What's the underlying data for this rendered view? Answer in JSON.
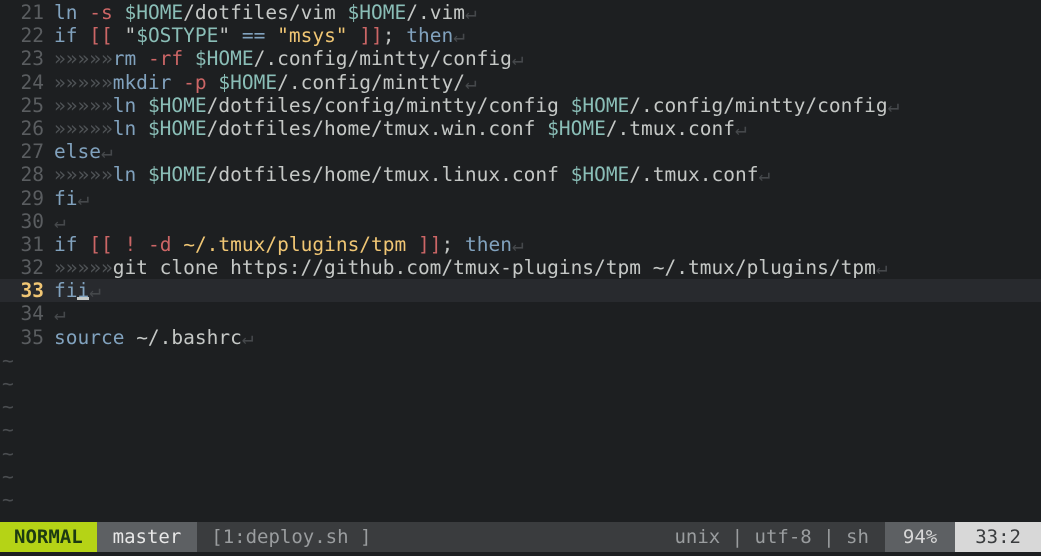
{
  "editor": {
    "name": "vim",
    "filetype": "sh",
    "tab_char": "»",
    "eol_char": "↵",
    "tilde_char": "~",
    "colors": {
      "background": "#1d1f21",
      "cursorline_bg": "#282a2e",
      "linenr": "#5a5d60",
      "cursor_linenr": "#f0c674",
      "keyword": "#81a2be",
      "operator": "#cc6666",
      "variable": "#8abeb7",
      "string": "#f0c674",
      "plain": "#c5c8c6",
      "tab_marker": "#4f5356",
      "eol_marker": "#45484b",
      "tilde": "#4a4d50",
      "mode_bg": "#b5d316",
      "mode_fg": "#1d3a12",
      "branch_bg": "#5d6063",
      "file_bg": "#3a3c3e",
      "pos_bg": "#d8d8d8"
    }
  },
  "lines": [
    {
      "number": "21",
      "cursor": false,
      "tokens": [
        {
          "cls": "t-kw",
          "text": "ln"
        },
        {
          "cls": "t-plain",
          "text": " "
        },
        {
          "cls": "t-op",
          "text": "-s"
        },
        {
          "cls": "t-plain",
          "text": " "
        },
        {
          "cls": "t-var",
          "text": "$HOME"
        },
        {
          "cls": "t-plain",
          "text": "/dotfiles/vim "
        },
        {
          "cls": "t-var",
          "text": "$HOME"
        },
        {
          "cls": "t-plain",
          "text": "/.vim"
        },
        {
          "cls": "t-eol",
          "text": "↵"
        }
      ]
    },
    {
      "number": "22",
      "cursor": false,
      "tokens": [
        {
          "cls": "t-kw",
          "text": "if"
        },
        {
          "cls": "t-plain",
          "text": " "
        },
        {
          "cls": "t-op",
          "text": "[["
        },
        {
          "cls": "t-plain",
          "text": " \""
        },
        {
          "cls": "t-var",
          "text": "$OSTYPE"
        },
        {
          "cls": "t-plain",
          "text": "\" "
        },
        {
          "cls": "t-kw",
          "text": "=="
        },
        {
          "cls": "t-plain",
          "text": " "
        },
        {
          "cls": "t-str",
          "text": "\"msys\""
        },
        {
          "cls": "t-plain",
          "text": " "
        },
        {
          "cls": "t-op",
          "text": "]]"
        },
        {
          "cls": "t-punct",
          "text": "; "
        },
        {
          "cls": "t-kw",
          "text": "then"
        },
        {
          "cls": "t-eol",
          "text": "↵"
        }
      ]
    },
    {
      "number": "23",
      "cursor": false,
      "tokens": [
        {
          "cls": "t-tab",
          "text": "»»»»»"
        },
        {
          "cls": "t-kw",
          "text": "rm"
        },
        {
          "cls": "t-plain",
          "text": " "
        },
        {
          "cls": "t-op",
          "text": "-rf"
        },
        {
          "cls": "t-plain",
          "text": " "
        },
        {
          "cls": "t-var",
          "text": "$HOME"
        },
        {
          "cls": "t-plain",
          "text": "/.config/mintty/config"
        },
        {
          "cls": "t-eol",
          "text": "↵"
        }
      ]
    },
    {
      "number": "24",
      "cursor": false,
      "tokens": [
        {
          "cls": "t-tab",
          "text": "»»»»»"
        },
        {
          "cls": "t-kw",
          "text": "mkdir"
        },
        {
          "cls": "t-plain",
          "text": " "
        },
        {
          "cls": "t-op",
          "text": "-p"
        },
        {
          "cls": "t-plain",
          "text": " "
        },
        {
          "cls": "t-var",
          "text": "$HOME"
        },
        {
          "cls": "t-plain",
          "text": "/.config/mintty/"
        },
        {
          "cls": "t-eol",
          "text": "↵"
        }
      ]
    },
    {
      "number": "25",
      "cursor": false,
      "tokens": [
        {
          "cls": "t-tab",
          "text": "»»»»»"
        },
        {
          "cls": "t-kw",
          "text": "ln"
        },
        {
          "cls": "t-plain",
          "text": " "
        },
        {
          "cls": "t-var",
          "text": "$HOME"
        },
        {
          "cls": "t-plain",
          "text": "/dotfiles/config/mintty/config "
        },
        {
          "cls": "t-var",
          "text": "$HOME"
        },
        {
          "cls": "t-plain",
          "text": "/.config/mintty/config"
        },
        {
          "cls": "t-eol",
          "text": "↵"
        }
      ]
    },
    {
      "number": "26",
      "cursor": false,
      "tokens": [
        {
          "cls": "t-tab",
          "text": "»»»»»"
        },
        {
          "cls": "t-kw",
          "text": "ln"
        },
        {
          "cls": "t-plain",
          "text": " "
        },
        {
          "cls": "t-var",
          "text": "$HOME"
        },
        {
          "cls": "t-plain",
          "text": "/dotfiles/home/tmux.win.conf "
        },
        {
          "cls": "t-var",
          "text": "$HOME"
        },
        {
          "cls": "t-plain",
          "text": "/.tmux.conf"
        },
        {
          "cls": "t-eol",
          "text": "↵"
        }
      ]
    },
    {
      "number": "27",
      "cursor": false,
      "tokens": [
        {
          "cls": "t-kw",
          "text": "else"
        },
        {
          "cls": "t-eol",
          "text": "↵"
        }
      ]
    },
    {
      "number": "28",
      "cursor": false,
      "tokens": [
        {
          "cls": "t-tab",
          "text": "»»»»»"
        },
        {
          "cls": "t-kw",
          "text": "ln"
        },
        {
          "cls": "t-plain",
          "text": " "
        },
        {
          "cls": "t-var",
          "text": "$HOME"
        },
        {
          "cls": "t-plain",
          "text": "/dotfiles/home/tmux.linux.conf "
        },
        {
          "cls": "t-var",
          "text": "$HOME"
        },
        {
          "cls": "t-plain",
          "text": "/.tmux.conf"
        },
        {
          "cls": "t-eol",
          "text": "↵"
        }
      ]
    },
    {
      "number": "29",
      "cursor": false,
      "tokens": [
        {
          "cls": "t-kw",
          "text": "fi"
        },
        {
          "cls": "t-eol",
          "text": "↵"
        }
      ]
    },
    {
      "number": "30",
      "cursor": false,
      "tokens": [
        {
          "cls": "t-eol",
          "text": "↵"
        }
      ]
    },
    {
      "number": "31",
      "cursor": false,
      "tokens": [
        {
          "cls": "t-kw",
          "text": "if"
        },
        {
          "cls": "t-plain",
          "text": " "
        },
        {
          "cls": "t-op",
          "text": "[["
        },
        {
          "cls": "t-plain",
          "text": " "
        },
        {
          "cls": "t-op",
          "text": "!"
        },
        {
          "cls": "t-plain",
          "text": " "
        },
        {
          "cls": "t-op",
          "text": "-d"
        },
        {
          "cls": "t-plain",
          "text": " "
        },
        {
          "cls": "t-path",
          "text": "~/.tmux/plugins/tpm"
        },
        {
          "cls": "t-plain",
          "text": " "
        },
        {
          "cls": "t-op",
          "text": "]]"
        },
        {
          "cls": "t-punct",
          "text": "; "
        },
        {
          "cls": "t-kw",
          "text": "then"
        },
        {
          "cls": "t-eol",
          "text": "↵"
        }
      ]
    },
    {
      "number": "32",
      "cursor": false,
      "tokens": [
        {
          "cls": "t-tab",
          "text": "»»»»»"
        },
        {
          "cls": "t-plain",
          "text": "git clone https://github.com/tmux-plugins/tpm ~/.tmux/plugins/tpm"
        },
        {
          "cls": "t-eol",
          "text": "↵"
        }
      ]
    },
    {
      "number": "33",
      "cursor": true,
      "cursor_after_index": 0,
      "tokens": [
        {
          "cls": "t-kw",
          "text": "fi"
        },
        {
          "cls": "t-eol",
          "text": "↵"
        }
      ]
    },
    {
      "number": "34",
      "cursor": false,
      "tokens": [
        {
          "cls": "t-eol",
          "text": "↵"
        }
      ]
    },
    {
      "number": "35",
      "cursor": false,
      "tokens": [
        {
          "cls": "t-kw",
          "text": "source"
        },
        {
          "cls": "t-plain",
          "text": " ~/.bashrc"
        },
        {
          "cls": "t-eol",
          "text": "↵"
        }
      ]
    }
  ],
  "tilde_rows": [
    "~",
    "~",
    "~",
    "~",
    "~",
    "~",
    "~"
  ],
  "status": {
    "mode": "NORMAL",
    "branch": "master",
    "file": "[1:deploy.sh ]",
    "fileinfo": "unix | utf-8 | sh",
    "percent": "94%",
    "position": "33:2"
  }
}
